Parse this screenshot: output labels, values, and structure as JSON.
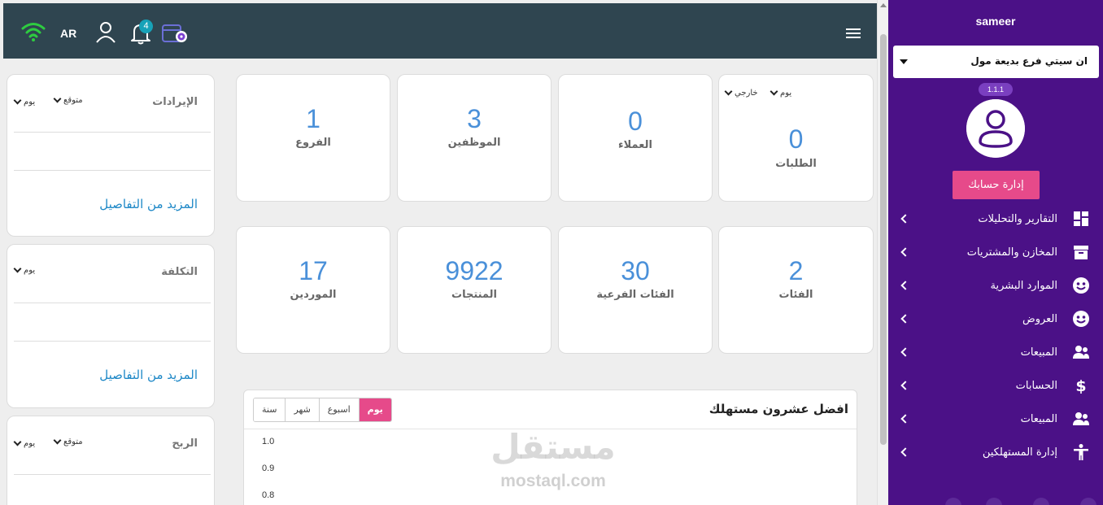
{
  "topbar": {
    "lang": "AR",
    "notifications_count": "4"
  },
  "stats_row1": [
    {
      "number": "1",
      "label": "الفروع"
    },
    {
      "number": "3",
      "label": "الموظفين"
    },
    {
      "number": "0",
      "label": "العملاء"
    },
    {
      "number": "0",
      "label": "الطلبات",
      "filter_left": "خارجي",
      "filter_right": "يوم"
    }
  ],
  "stats_row2": [
    {
      "number": "17",
      "label": "الموردين"
    },
    {
      "number": "9922",
      "label": "المنتجات"
    },
    {
      "number": "30",
      "label": "الفئات الفرعية"
    },
    {
      "number": "2",
      "label": "الفئات"
    }
  ],
  "finance": [
    {
      "title": "الإيرادات",
      "filter_a": "يوم",
      "filter_b": "متوقع",
      "more": "المزيد من التفاصيل"
    },
    {
      "title": "التكلفة",
      "filter_a": "يوم",
      "more": "المزيد من التفاصيل"
    },
    {
      "title": "الربح",
      "filter_a": "يوم",
      "filter_b": "متوقع"
    }
  ],
  "chart": {
    "title": "افضل عشرون مستهلك",
    "tabs": [
      "سنة",
      "شهر",
      "اسبوع",
      "يوم"
    ],
    "active_tab": "يوم"
  },
  "chart_data": {
    "type": "bar",
    "title": "افضل عشرون مستهلك",
    "categories": [],
    "values": [],
    "yticks": [
      "1.0",
      "0.9",
      "0.8"
    ],
    "ylim": [
      0.8,
      1.0
    ]
  },
  "watermark": {
    "arabic": "مستقل",
    "latin": "mostaql.com"
  },
  "sidebar": {
    "username": "sameer",
    "branch": "ان سيتي فرع بديعة مول",
    "version": "1.1.1",
    "account_button": "إدارة حسابك",
    "items": [
      {
        "label": "التقارير والتحليلات",
        "icon": "dashboard-icon"
      },
      {
        "label": "المخازن والمشتريات",
        "icon": "archive-box-icon"
      },
      {
        "label": "الموارد البشرية",
        "icon": "smiley-face-icon"
      },
      {
        "label": "العروض",
        "icon": "smiley-face-icon"
      },
      {
        "label": "المبيعات",
        "icon": "people-icon"
      },
      {
        "label": "الحسابات",
        "icon": "dollar-icon"
      },
      {
        "label": "المبيعات",
        "icon": "people-icon"
      },
      {
        "label": "إدارة المستهلكين",
        "icon": "person-standing-icon"
      }
    ]
  },
  "colors": {
    "topbar": "#2f4550",
    "sidebar": "#4b1187",
    "accent_pink": "#e64a8a",
    "stat_blue": "#4a90d9",
    "link_blue": "#1e88c7"
  }
}
